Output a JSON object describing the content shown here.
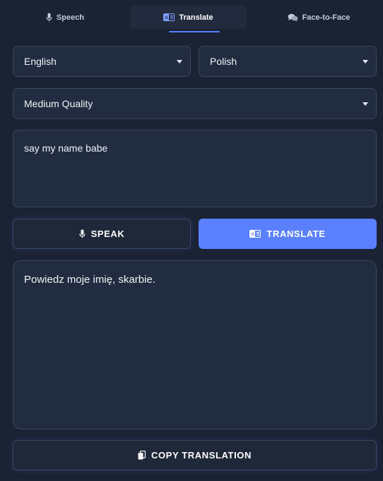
{
  "tabs": [
    {
      "label": "Speech",
      "icon": "microphone-icon"
    },
    {
      "label": "Translate",
      "icon": "translate-icon",
      "active": true
    },
    {
      "label": "Face-to-Face",
      "icon": "chat-bubbles-icon"
    }
  ],
  "selects": {
    "source_language": "English",
    "target_language": "Polish",
    "quality": "Medium Quality"
  },
  "input": {
    "text": "say my name babe"
  },
  "buttons": {
    "speak_label": "SPEAK",
    "translate_label": "TRANSLATE",
    "copy_label": "COPY TRANSLATION"
  },
  "output": {
    "text": "Powiedz moje imię, skarbie."
  },
  "colors": {
    "background": "#1a2233",
    "panel": "#222c40",
    "border": "#3a4660",
    "accent": "#5a80ff"
  }
}
